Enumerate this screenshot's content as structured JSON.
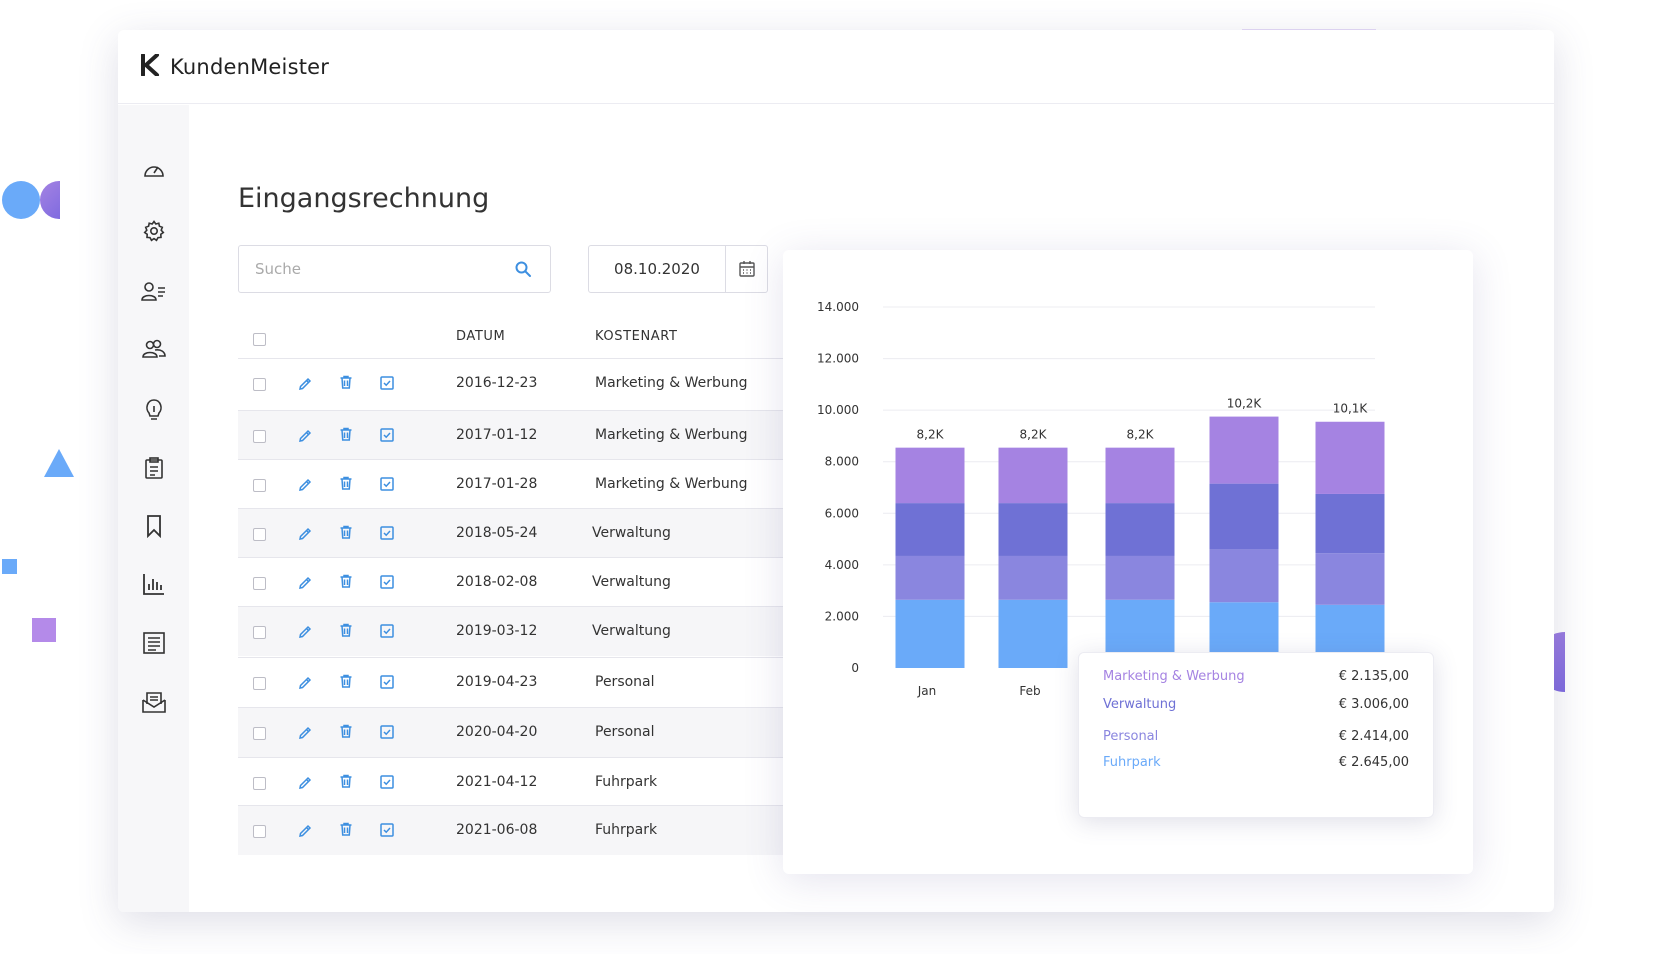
{
  "app": {
    "name": "KundenMeister"
  },
  "sidebar": {
    "items": [
      {
        "icon": "dashboard-gauge-icon"
      },
      {
        "icon": "gear-icon"
      },
      {
        "icon": "user-list-icon"
      },
      {
        "icon": "users-group-icon"
      },
      {
        "icon": "lightbulb-icon"
      },
      {
        "icon": "clipboard-icon"
      },
      {
        "icon": "bookmark-icon"
      },
      {
        "icon": "bar-chart-icon"
      },
      {
        "icon": "document-list-icon"
      },
      {
        "icon": "mail-inbox-icon"
      }
    ]
  },
  "page": {
    "title": "Eingangsrechnung"
  },
  "search": {
    "placeholder": "Suche"
  },
  "date_filter": {
    "value": "08.10.2020"
  },
  "table": {
    "headers": {
      "date": "DATUM",
      "cost_type": "KOSTENART"
    },
    "rows": [
      {
        "date": "2016-12-23",
        "cost_type": "Marketing & Werbung"
      },
      {
        "date": "2017-01-12",
        "cost_type": "Marketing & Werbung"
      },
      {
        "date": "2017-01-28",
        "cost_type": "Marketing & Werbung"
      },
      {
        "date": "2018-05-24",
        "cost_type": "Verwaltung"
      },
      {
        "date": "2018-02-08",
        "cost_type": "Verwaltung"
      },
      {
        "date": "2019-03-12",
        "cost_type": "Verwaltung"
      },
      {
        "date": "2019-04-23",
        "cost_type": "Personal"
      },
      {
        "date": "2020-04-20",
        "cost_type": "Personal"
      },
      {
        "date": "2021-04-12",
        "cost_type": "Fuhrpark"
      },
      {
        "date": "2021-06-08",
        "cost_type": "Fuhrpark"
      }
    ]
  },
  "colors": {
    "accent_blue": "#3d8fe0",
    "fuhrpark": "#6aaaf9",
    "personal": "#8a86df",
    "verwaltung": "#6f71d5",
    "marketing": "#a583e2"
  },
  "chart_data": {
    "type": "bar",
    "stacked": true,
    "categories": [
      "Jan",
      "Feb",
      "",
      "",
      ""
    ],
    "ylim": [
      0,
      14000
    ],
    "yticks": [
      "0",
      "2.000",
      "4.000",
      "6.000",
      "8.000",
      "10.000",
      "12.000",
      "14.000"
    ],
    "grid": true,
    "series": [
      {
        "name": "Fuhrpark",
        "color": "#6aaaf9",
        "values": [
          2645,
          2645,
          2645,
          2550,
          2450
        ]
      },
      {
        "name": "Personal",
        "color": "#8a86df",
        "values": [
          1700,
          1700,
          1700,
          2050,
          2000
        ]
      },
      {
        "name": "Verwaltung",
        "color": "#6f71d5",
        "values": [
          2050,
          2050,
          2050,
          2550,
          2300
        ]
      },
      {
        "name": "Marketing & Werbung",
        "color": "#a583e2",
        "values": [
          2150,
          2150,
          2150,
          2600,
          2800
        ]
      }
    ],
    "totals_labels": [
      "8,2K",
      "8,2K",
      "8,2K",
      "10,2K",
      "10,1K"
    ]
  },
  "tooltip": {
    "rows": [
      {
        "label": "Marketing & Werbung",
        "value": "€ 2.135,00",
        "color": "#a583e2"
      },
      {
        "label": "Verwaltung",
        "value": "€ 3.006,00",
        "color": "#6f71d5"
      },
      {
        "label": "Personal",
        "value": "€ 2.414,00",
        "color": "#8a86df"
      },
      {
        "label": "Fuhrpark",
        "value": "€ 2.645,00",
        "color": "#6aaaf9"
      }
    ]
  }
}
